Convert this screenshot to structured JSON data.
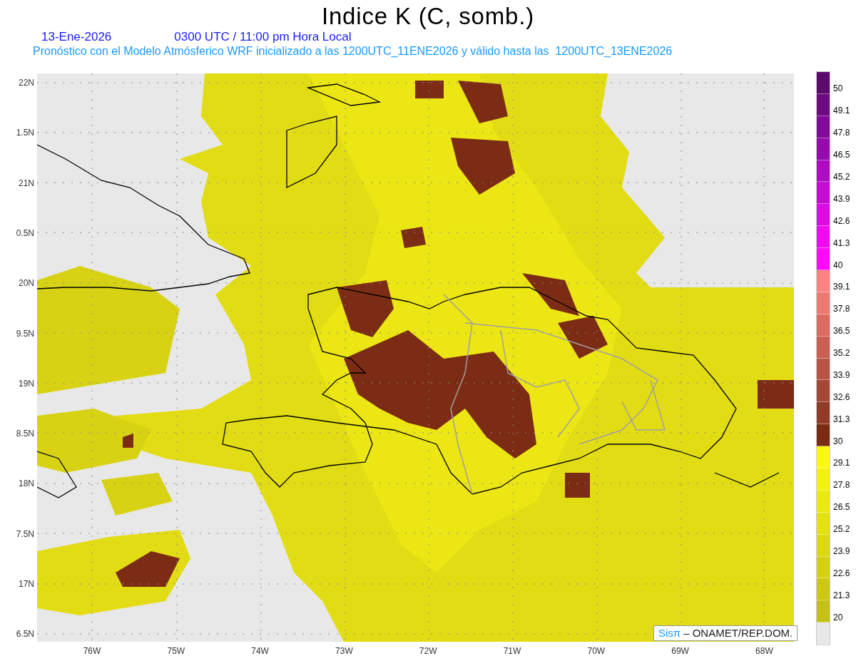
{
  "title": "Indice K (C, somb.)",
  "date": "13-Ene-2026",
  "time": "0300 UTC / 11:00 pm Hora Local",
  "subtitle": "Pronóstico con el Modelo Atmósferico WRF inicializado a las 1200UTC_11ENE2026 y válido hasta las  1200UTC_13ENE2026",
  "y_axis_labels": [
    "22N",
    "1.5N",
    "21N",
    "0.5N",
    "20N",
    "9.5N",
    "19N",
    "8.5N",
    "18N",
    "7.5N",
    "17N",
    "6.5N"
  ],
  "x_axis_labels": [
    "76W",
    "75W",
    "74W",
    "73W",
    "72W",
    "71W",
    "70W",
    "69W",
    "68W"
  ],
  "colorbar": [
    {
      "color": "#5c0a6e",
      "label": "50"
    },
    {
      "color": "#6e0a82",
      "label": "49.1"
    },
    {
      "color": "#820a98",
      "label": "47.8"
    },
    {
      "color": "#960aae",
      "label": "46.5"
    },
    {
      "color": "#b00ac4",
      "label": "45.2"
    },
    {
      "color": "#c80ad6",
      "label": "43.9"
    },
    {
      "color": "#dc0ae6",
      "label": "42.6"
    },
    {
      "color": "#ee0af2",
      "label": "41.3"
    },
    {
      "color": "#ff0aff",
      "label": "40"
    },
    {
      "color": "#ff8282",
      "label": "39.1"
    },
    {
      "color": "#ec7870",
      "label": "37.8"
    },
    {
      "color": "#dc6c62",
      "label": "36.5"
    },
    {
      "color": "#ca6052",
      "label": "35.2"
    },
    {
      "color": "#b85444",
      "label": "33.9"
    },
    {
      "color": "#a44836",
      "label": "32.6"
    },
    {
      "color": "#903c26",
      "label": "31.3"
    },
    {
      "color": "#7c2c14",
      "label": "30"
    },
    {
      "color": "#fcf814",
      "label": "29.1"
    },
    {
      "color": "#f4f014",
      "label": "27.8"
    },
    {
      "color": "#ece814",
      "label": "26.5"
    },
    {
      "color": "#e4e014",
      "label": "25.2"
    },
    {
      "color": "#dcd814",
      "label": "23.9"
    },
    {
      "color": "#d4d014",
      "label": "22.6"
    },
    {
      "color": "#ccc814",
      "label": "21.3"
    },
    {
      "color": "#c4c018",
      "label": "20"
    },
    {
      "color": "#e8e8e8"
    }
  ],
  "credit": {
    "logo": "Sisπ",
    "text": "– ONAMET/REP.DOM."
  }
}
